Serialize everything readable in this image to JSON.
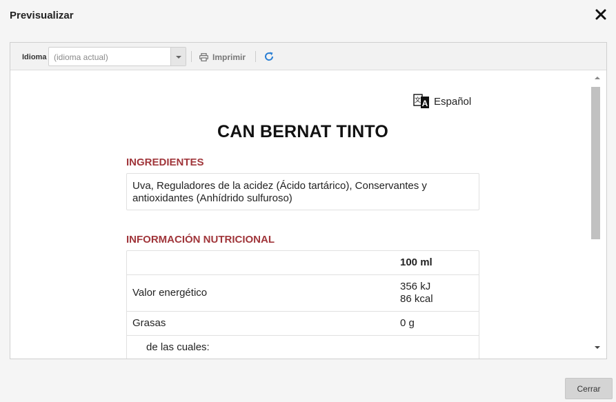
{
  "dialog": {
    "title": "Previsualizar"
  },
  "toolbar": {
    "language_label": "Idioma",
    "language_select_value": "(idioma actual)",
    "print_label": "Imprimir"
  },
  "preview": {
    "language_badge": "Español",
    "product_name": "CAN BERNAT TINTO",
    "ingredients_title": "INGREDIENTES",
    "ingredients_text": "Uva, Reguladores de la acidez (Ácido tartárico), Conservantes y antioxidantes (Anhídrido sulfuroso)",
    "nutrition_title": "INFORMACIÓN NUTRICIONAL",
    "nutrition_header": "100 ml",
    "nutrition_rows": [
      {
        "name": "Valor energético",
        "value_line1": "356 kJ",
        "value_line2": "86 kcal"
      },
      {
        "name": "Grasas",
        "value_line1": "0 g"
      },
      {
        "name": "de las cuales:",
        "value_line1": ""
      }
    ]
  },
  "footer": {
    "close_label": "Cerrar"
  }
}
